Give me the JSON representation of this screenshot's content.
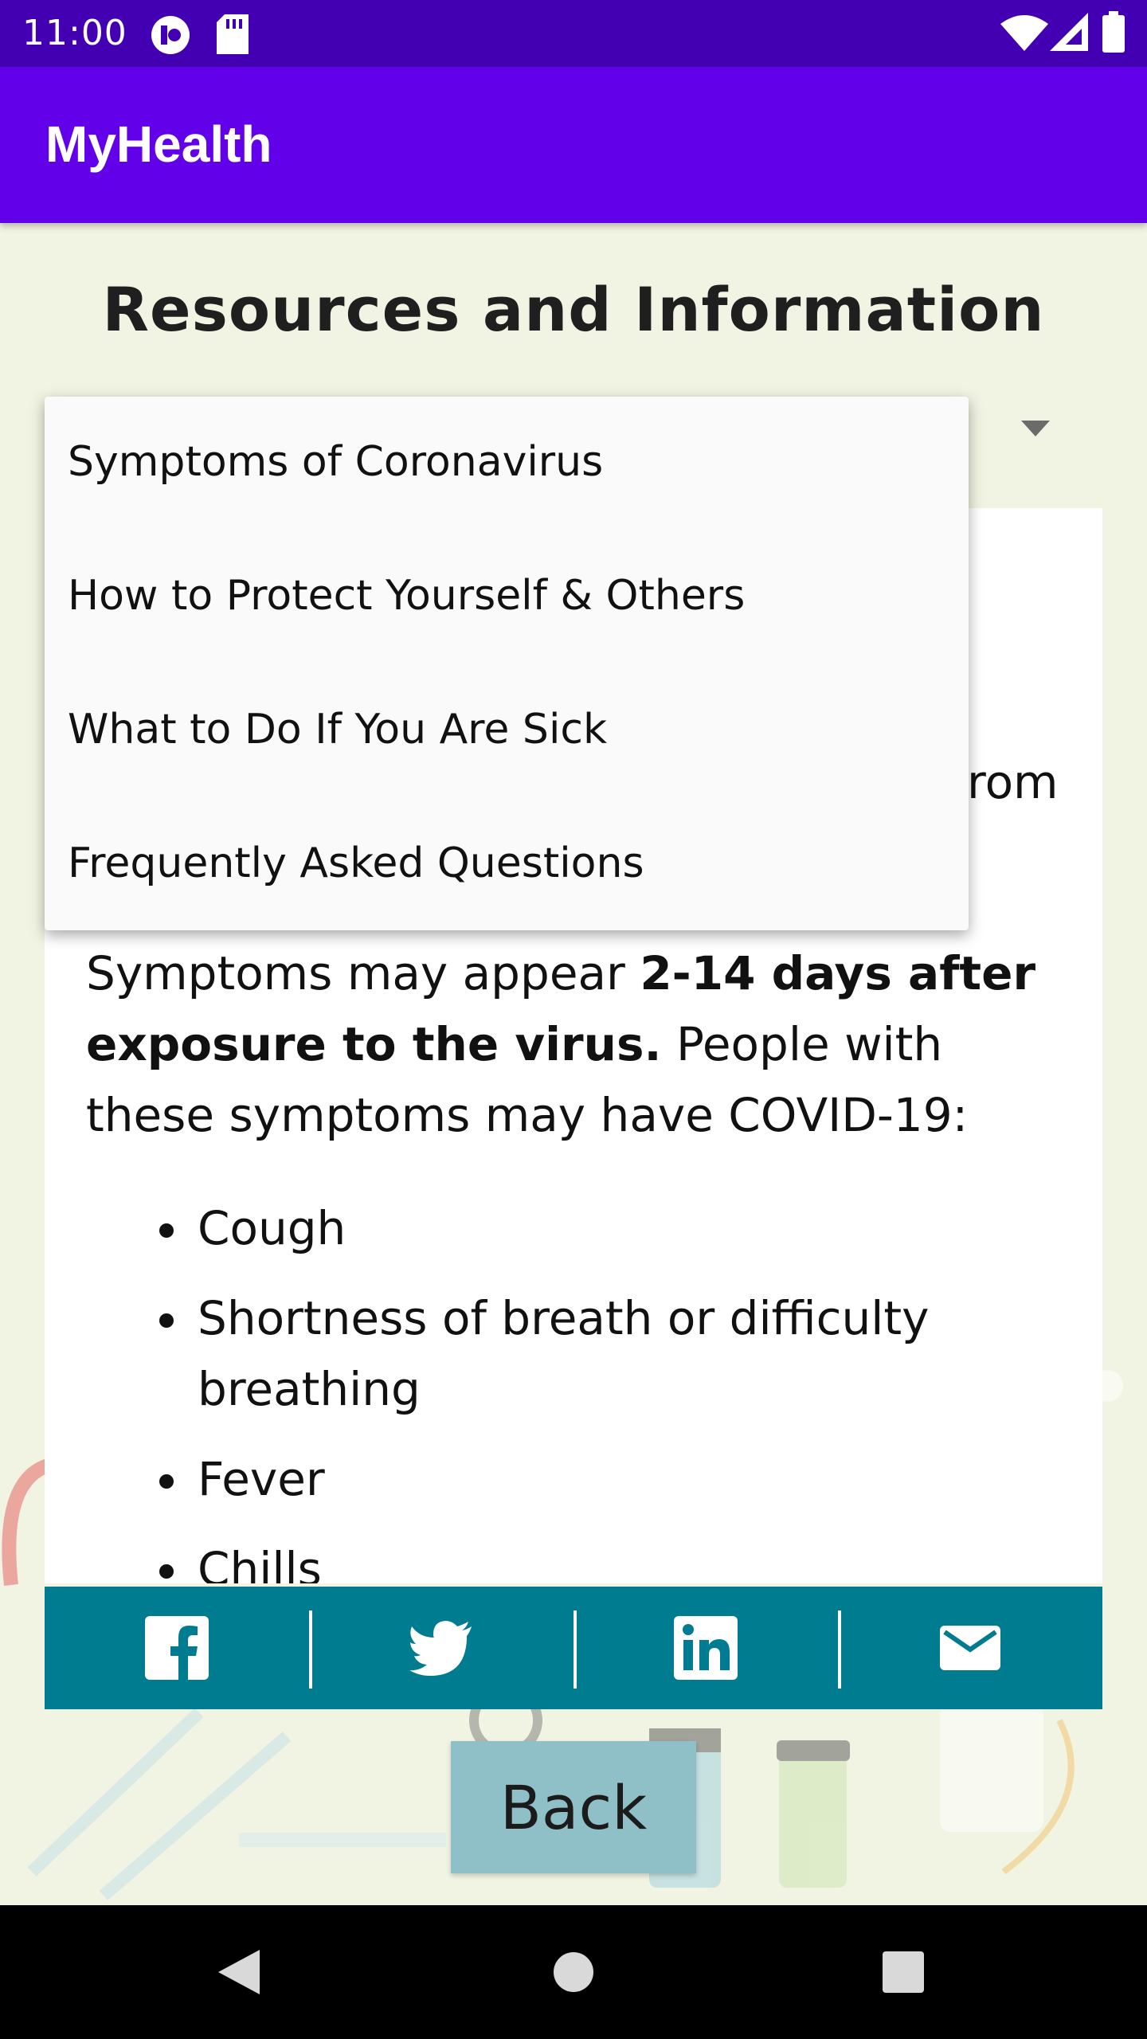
{
  "status_bar": {
    "time": "11:00",
    "icons": [
      "app-notification-icon",
      "sd-card-icon",
      "wifi-icon",
      "cell-signal-icon",
      "battery-icon"
    ]
  },
  "app_bar": {
    "title": "MyHealth",
    "color": "#6200ea"
  },
  "page": {
    "title": "Resources and Information",
    "spinner_arrow_icon": "chevron-down-icon"
  },
  "content": {
    "partial_text": "rom",
    "intro_parts": {
      "p1": "Symptoms may appear ",
      "p2_bold": "2-14 days after exposure to the virus.",
      "p3": " People with these symptoms may have COVID-19:"
    },
    "symptoms": [
      "Cough",
      "Shortness of breath or difficulty breathing",
      "Fever",
      "Chills"
    ]
  },
  "share_bar": {
    "color": "#007c91",
    "items": [
      "facebook-icon",
      "twitter-icon",
      "linkedin-icon",
      "email-icon"
    ]
  },
  "back_button": {
    "label": "Back"
  },
  "dropdown": {
    "items": [
      "Symptoms of Coronavirus",
      "How to Protect Yourself & Others",
      "What to Do If You Are Sick",
      "Frequently Asked Questions"
    ]
  },
  "nav_bar": {
    "icons": [
      "back-triangle-icon",
      "home-circle-icon",
      "recents-square-icon"
    ]
  }
}
